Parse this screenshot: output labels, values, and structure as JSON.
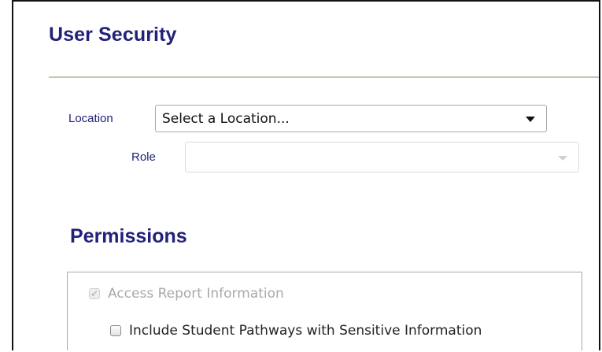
{
  "header": {
    "title": "User Security"
  },
  "filters": {
    "location": {
      "label": "Location",
      "value": "Select a Location..."
    },
    "role": {
      "label": "Role",
      "value": ""
    }
  },
  "permissions": {
    "title": "Permissions",
    "items": [
      {
        "label": "Access Report Information",
        "checked": true,
        "disabled": true
      },
      {
        "label": "Include Student Pathways with Sensitive Information",
        "checked": false,
        "disabled": false
      }
    ]
  },
  "colors": {
    "heading": "#21217a",
    "divider": "#c9c3ad",
    "border": "#a9a9a9"
  },
  "icons": {
    "dropdown": "chevron-down-icon",
    "check": "checkmark-icon"
  }
}
